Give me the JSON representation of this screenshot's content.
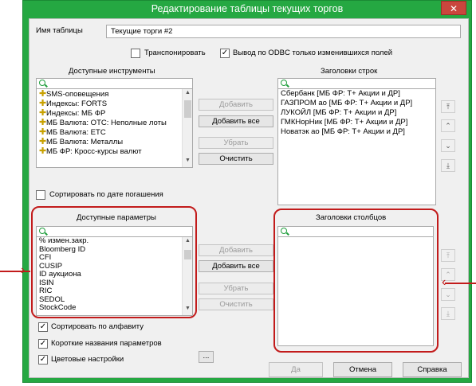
{
  "window": {
    "title": "Редактирование таблицы текущих торгов",
    "close": "✕"
  },
  "table_name": {
    "label": "Имя таблицы",
    "value": "Текущие торги #2"
  },
  "options": {
    "transpose": {
      "label": "Транспонировать",
      "checked": false
    },
    "odbc": {
      "label": "Вывод по ODBC только изменившихся  полей",
      "checked": true
    }
  },
  "instruments": {
    "title": "Доступные инструменты",
    "items": [
      "SMS-оповещения",
      "Индексы: FORTS",
      "Индексы: МБ ФР",
      "МБ Валюта: ОТС: Неполные лоты",
      "МБ Валюта: ЕТС",
      "МБ Валюта: Металлы",
      "МБ ФР: Кросс-курсы валют"
    ],
    "sort_by_expiry": {
      "label": "Сортировать по дате погашения",
      "checked": false
    }
  },
  "row_headers": {
    "title": "Заголовки строк",
    "items": [
      "Сбербанк [МБ ФР: Т+ Акции и ДР]",
      "ГАЗПРОМ ао [МБ ФР: Т+ Акции и ДР]",
      "ЛУКОЙЛ [МБ ФР: Т+ Акции и ДР]",
      "ГМКНорНик [МБ ФР: Т+ Акции и ДР]",
      "Новатэк ао [МБ ФР: Т+ Акции и ДР]"
    ]
  },
  "params": {
    "title": "Доступные параметры",
    "items": [
      "% измен.закр.",
      "Bloomberg ID",
      "CFI",
      "CUSIP",
      "ID аукциона",
      "ISIN",
      "RIC",
      "SEDOL",
      "StockCode"
    ]
  },
  "col_headers": {
    "title": "Заголовки столбцов",
    "items": []
  },
  "buttons": {
    "add": "Добавить",
    "add_all": "Добавить все",
    "remove": "Убрать",
    "clear": "Очистить"
  },
  "bottom_checks": {
    "sort_alpha": {
      "label": "Сортировать по алфавиту",
      "checked": true
    },
    "short_names": {
      "label": "Короткие названия параметров",
      "checked": true
    },
    "color_settings": {
      "label": "Цветовые настройки",
      "checked": true
    },
    "ellipsis": "..."
  },
  "dialog": {
    "ok": "Да",
    "cancel": "Отмена",
    "help": "Справка"
  },
  "icons": {
    "add_item": "plus-icon",
    "search": "search-icon",
    "move_top": "move-top-icon",
    "move_up": "move-up-icon",
    "move_down": "move-down-icon",
    "move_bottom": "move-bottom-icon"
  }
}
